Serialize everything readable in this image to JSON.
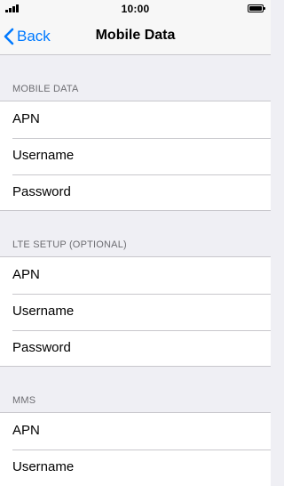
{
  "status_bar": {
    "time": "10:00",
    "signal_icon": "signal-bars-icon",
    "battery_icon": "battery-full-icon"
  },
  "nav": {
    "back_label": "Back",
    "back_icon": "chevron-left-icon",
    "title": "Mobile Data",
    "accent_color": "#007aff"
  },
  "sections": [
    {
      "header": "MOBILE DATA",
      "items": [
        {
          "label": "APN"
        },
        {
          "label": "Username"
        },
        {
          "label": "Password"
        }
      ]
    },
    {
      "header": "LTE SETUP (OPTIONAL)",
      "items": [
        {
          "label": "APN"
        },
        {
          "label": "Username"
        },
        {
          "label": "Password"
        }
      ]
    },
    {
      "header": "MMS",
      "items": [
        {
          "label": "APN"
        },
        {
          "label": "Username"
        }
      ]
    }
  ]
}
